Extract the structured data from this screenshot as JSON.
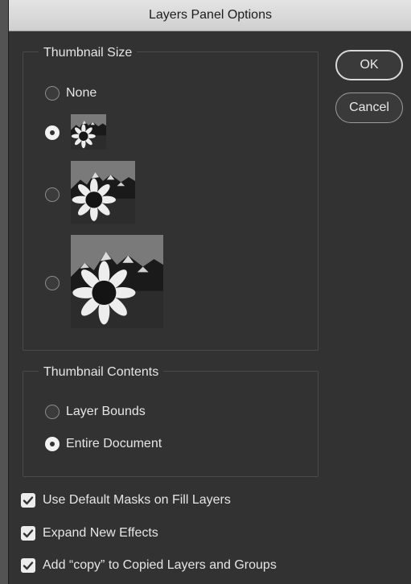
{
  "dialog": {
    "title": "Layers Panel Options"
  },
  "thumbnail_size": {
    "title": "Thumbnail Size",
    "options": [
      {
        "label": "None",
        "selected": false
      },
      {
        "label": "",
        "size": "small",
        "selected": true
      },
      {
        "label": "",
        "size": "medium",
        "selected": false
      },
      {
        "label": "",
        "size": "large",
        "selected": false
      }
    ]
  },
  "thumbnail_contents": {
    "title": "Thumbnail Contents",
    "options": [
      {
        "label": "Layer Bounds",
        "selected": false
      },
      {
        "label": "Entire Document",
        "selected": true
      }
    ]
  },
  "buttons": {
    "ok_label": "OK",
    "cancel_label": "Cancel"
  },
  "checkboxes": [
    {
      "label": "Use Default Masks on Fill Layers",
      "checked": true
    },
    {
      "label": "Expand New Effects",
      "checked": true
    },
    {
      "label": "Add “copy” to Copied Layers and Groups",
      "checked": true
    }
  ],
  "icons": {
    "checkmark": "check-icon",
    "thumbnail": "sunflower-mountain-thumbnail"
  },
  "colors": {
    "dialog_bg": "#323232",
    "title_bar": "#d9d9d9",
    "text": "#e6e6e6"
  }
}
